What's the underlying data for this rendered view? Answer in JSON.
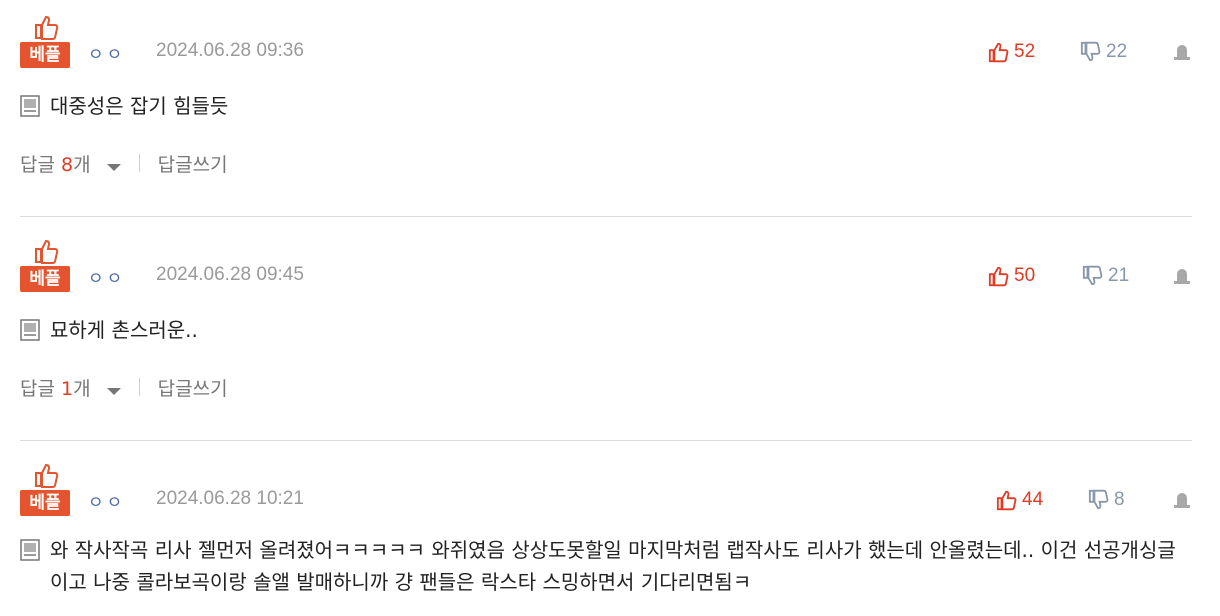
{
  "best_label": "베플",
  "reply_label": "답글",
  "reply_unit": "개",
  "write_reply_label": "답글쓰기",
  "colors": {
    "accent": "#e4542e",
    "upvote": "#e03b24",
    "downvote": "#8a97aa",
    "nickname": "#4d6aa8"
  },
  "icons": {
    "best": "thumbs-up-icon",
    "up": "thumbs-up-icon",
    "down": "thumbs-down-icon",
    "report": "report-icon",
    "memo": "memo-icon"
  },
  "comments": [
    {
      "nickname": "ㅇㅇ",
      "date": "2024.06.28 09:36",
      "upvotes": "52",
      "downvotes": "22",
      "text": "대중성은 잡기 힘들듯",
      "reply_count": "8"
    },
    {
      "nickname": "ㅇㅇ",
      "date": "2024.06.28 09:45",
      "upvotes": "50",
      "downvotes": "21",
      "text": "묘하게 촌스러운..",
      "reply_count": "1"
    },
    {
      "nickname": "ㅇㅇ",
      "date": "2024.06.28 10:21",
      "upvotes": "44",
      "downvotes": "8",
      "text": "와 작사작곡 리사 젤먼저 올려졌어ㅋㅋㅋㅋㅋ 와쥐였음 상상도못할일 마지막처럼 랩작사도 리사가 했는데 안올렸는데.. 이건 선공개싱글이고 나중 콜라보곡이랑 솔앨 발매하니까 걍 팬들은 락스타 스밍하면서 기다리면됨ㅋ"
    }
  ]
}
